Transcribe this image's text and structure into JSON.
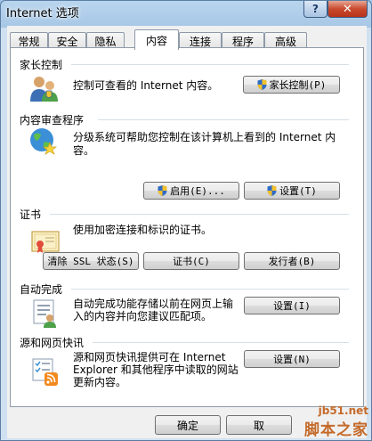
{
  "window": {
    "title": "Internet 选项",
    "help_glyph": "?",
    "close_glyph": "✕"
  },
  "tabs": [
    {
      "label": "常规"
    },
    {
      "label": "安全"
    },
    {
      "label": "隐私"
    },
    {
      "label": "内容",
      "active": true
    },
    {
      "label": "连接"
    },
    {
      "label": "程序"
    },
    {
      "label": "高级"
    }
  ],
  "sections": {
    "parental": {
      "title": "家长控制",
      "desc": "控制可查看的 Internet 内容。",
      "button": "家长控制(P)"
    },
    "advisor": {
      "title": "内容审查程序",
      "desc_line1": "分级系统可帮助您控制在该计算机上看到的 Internet 内",
      "desc_line2": "容。",
      "enable_button": "启用(E)...",
      "settings_button": "设置(T)"
    },
    "certificates": {
      "title": "证书",
      "desc": "使用加密连接和标识的证书。",
      "clear_ssl_button": "清除 SSL 状态(S)",
      "certs_button": "证书(C)",
      "publishers_button": "发行者(B)"
    },
    "autocomplete": {
      "title": "自动完成",
      "desc_line1": "自动完成功能存储以前在网页上输",
      "desc_line2": "入的内容并向您建议匹配项。",
      "settings_button": "设置(I)"
    },
    "feeds": {
      "title": "源和网页快讯",
      "desc_line1": "源和网页快讯提供可在 Internet",
      "desc_line2": "Explorer 和其他程序中读取的网站",
      "desc_line3": "更新内容。",
      "settings_button": "设置(N)"
    }
  },
  "footer": {
    "ok_button": "确定",
    "cancel_button": "取"
  },
  "watermark": {
    "url": "jb51.net",
    "name": "脚本之家"
  }
}
